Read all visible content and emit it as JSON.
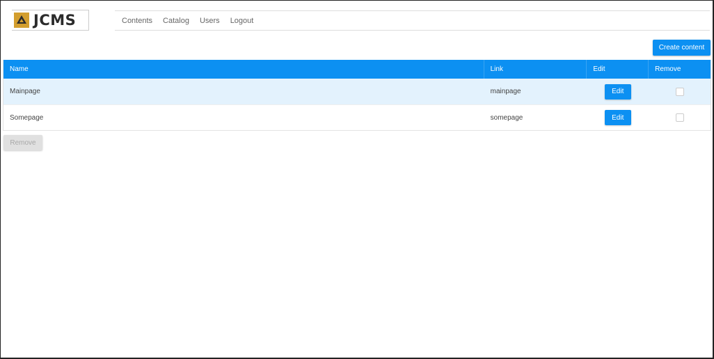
{
  "app": {
    "logo_text": "JCMS"
  },
  "nav": {
    "items": [
      {
        "label": "Contents"
      },
      {
        "label": "Catalog"
      },
      {
        "label": "Users"
      },
      {
        "label": "Logout"
      }
    ]
  },
  "toolbar": {
    "create_label": "Create content"
  },
  "table": {
    "headers": {
      "name": "Name",
      "link": "Link",
      "edit": "Edit",
      "remove": "Remove"
    },
    "rows": [
      {
        "name": "Mainpage",
        "link": "mainpage",
        "edit_label": "Edit",
        "remove_checked": false
      },
      {
        "name": "Somepage",
        "link": "somepage",
        "edit_label": "Edit",
        "remove_checked": false
      }
    ]
  },
  "actions": {
    "remove_label": "Remove"
  },
  "colors": {
    "accent": "#0c90f2",
    "selected_row": "#e3f2fd",
    "logo_mark": "#d39e2e"
  }
}
